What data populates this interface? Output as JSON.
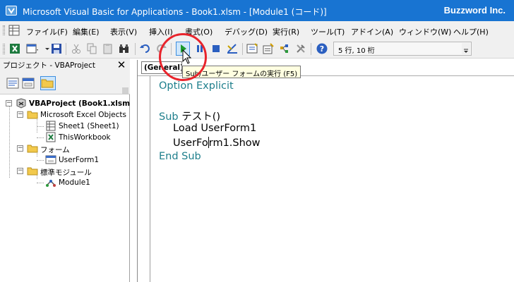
{
  "window": {
    "title": "Microsoft Visual Basic for Applications - Book1.xlsm - [Module1 (コード)]",
    "brand": "Buzzword Inc."
  },
  "menu": {
    "items": [
      {
        "label": "ファイル(F)"
      },
      {
        "label": "編集(E)"
      },
      {
        "label": "表示(V)"
      },
      {
        "label": "挿入(I)"
      },
      {
        "label": "書式(O)"
      },
      {
        "label": "デバッグ(D)"
      },
      {
        "label": "実行(R)"
      },
      {
        "label": "ツール(T)"
      },
      {
        "label": "アドイン(A)"
      },
      {
        "label": "ウィンドウ(W)"
      },
      {
        "label": "ヘルプ(H)"
      }
    ]
  },
  "toolbar": {
    "position_readout": "5 行, 10 桁",
    "run_tooltip": "Sub/ユーザー フォームの実行 (F5)",
    "icons": [
      "excel-icon",
      "insert-userform-icon",
      "save-icon",
      "cut-icon",
      "copy-icon",
      "paste-icon",
      "find-icon",
      "undo-icon",
      "redo-icon",
      "run-icon",
      "break-icon",
      "reset-icon",
      "design-mode-icon",
      "project-explorer-icon",
      "properties-icon",
      "object-browser-icon",
      "toolbox-icon",
      "help-icon"
    ]
  },
  "project_pane": {
    "title": "プロジェクト - VBAProject",
    "close_label": "✕",
    "tree": {
      "project": "VBAProject (Book1.xlsm)",
      "excel_objects": "Microsoft Excel Objects",
      "sheet1": "Sheet1 (Sheet1)",
      "thisworkbook": "ThisWorkbook",
      "forms": "フォーム",
      "userform1": "UserForm1",
      "modules": "標準モジュール",
      "module1": "Module1"
    }
  },
  "code_window": {
    "object_combo": "(General)",
    "lines": {
      "l1": "Option Explicit",
      "l3_kw": "Sub",
      "l3_rest": " テスト()",
      "l4": "Load UserForm1",
      "l5_a": "UserFo",
      "l5_b": "rm1.Show",
      "l6": "End Sub"
    }
  },
  "colors": {
    "titlebar": "#1874d2",
    "keyword": "#1e7f8c",
    "highlight": "#e8242c"
  }
}
